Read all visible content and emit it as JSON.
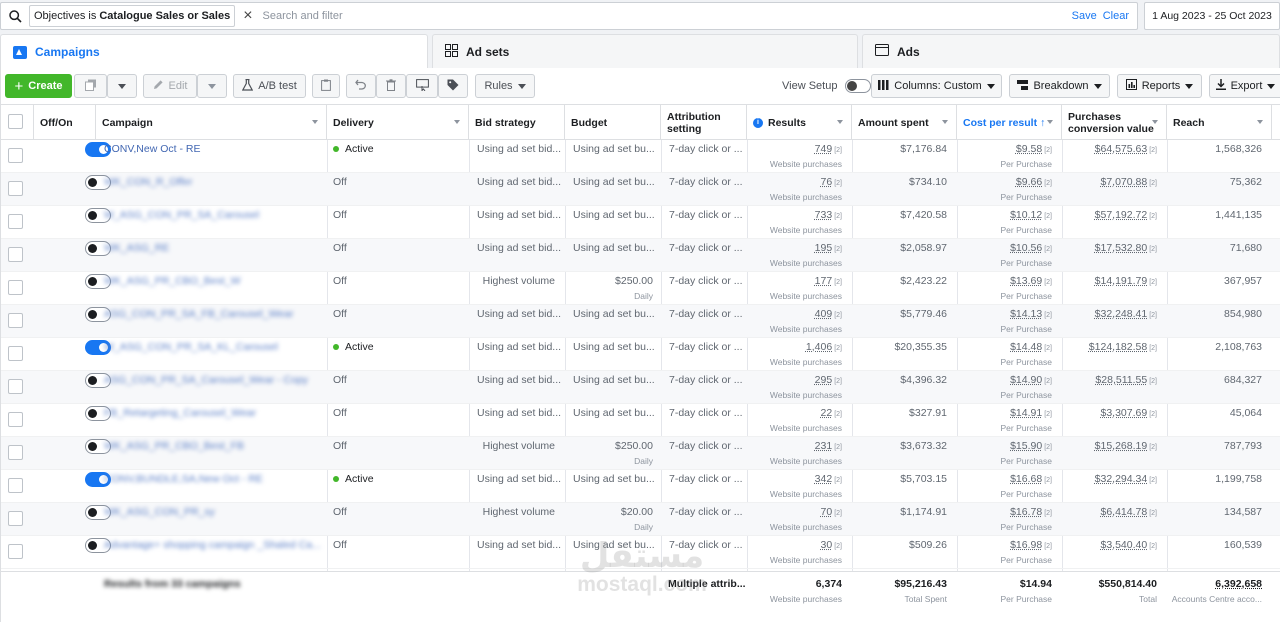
{
  "filter": {
    "chip_prefix": "Objectives is",
    "chip_value": "Catalogue Sales or Sales",
    "placeholder": "Search and filter",
    "save": "Save",
    "clear": "Clear",
    "date_range": "1 Aug 2023 - 25 Oct 2023"
  },
  "tabs": {
    "campaigns": "Campaigns",
    "adsets": "Ad sets",
    "ads": "Ads"
  },
  "toolbar": {
    "create": "Create",
    "edit": "Edit",
    "ab_test": "A/B test",
    "rules": "Rules",
    "view_setup": "View Setup",
    "columns": "Columns: Custom",
    "breakdown": "Breakdown",
    "reports": "Reports",
    "export": "Export"
  },
  "columns": {
    "offon": "Off/On",
    "campaign": "Campaign",
    "delivery": "Delivery",
    "bid": "Bid strategy",
    "budget": "Budget",
    "attribution_1": "Attribution",
    "attribution_2": "setting",
    "results": "Results",
    "spent": "Amount spent",
    "cpr": "Cost per result",
    "pcv_1": "Purchases",
    "pcv_2": "conversion value",
    "reach": "Reach"
  },
  "rows": [
    {
      "on": true,
      "campaign": "CONV,New Oct - RE",
      "blur": false,
      "delivery": "Active",
      "active": true,
      "bid": "Using ad set bid...",
      "budget": "Using ad set bu...",
      "budget_sub": "",
      "attribution": "7-day click or ...",
      "results": "749",
      "results_sub": "Website purchases",
      "spent": "$7,176.84",
      "cpr": "$9.58",
      "cpr_sub": "Per Purchase",
      "pcv": "$64,575.63",
      "reach": "1,568,326"
    },
    {
      "on": false,
      "campaign": "WK_CON_R_Offer",
      "blur": true,
      "delivery": "Off",
      "active": false,
      "bid": "Using ad set bid...",
      "budget": "Using ad set bu...",
      "budget_sub": "",
      "attribution": "7-day click or ...",
      "results": "76",
      "results_sub": "Website purchases",
      "spent": "$734.10",
      "cpr": "$9.66",
      "cpr_sub": "Per Purchase",
      "pcv": "$7,070.88",
      "reach": "75,362"
    },
    {
      "on": false,
      "campaign": "W_ASG_CON_PR_SA_Carousel",
      "blur": true,
      "delivery": "Off",
      "active": false,
      "bid": "Using ad set bid...",
      "budget": "Using ad set bu...",
      "budget_sub": "",
      "attribution": "7-day click or ...",
      "results": "733",
      "results_sub": "Website purchases",
      "spent": "$7,420.58",
      "cpr": "$10.12",
      "cpr_sub": "Per Purchase",
      "pcv": "$57,192.72",
      "reach": "1,441,135"
    },
    {
      "on": false,
      "campaign": "WK_ASG_RE",
      "blur": true,
      "delivery": "Off",
      "active": false,
      "bid": "Using ad set bid...",
      "budget": "Using ad set bu...",
      "budget_sub": "",
      "attribution": "7-day click or ...",
      "results": "195",
      "results_sub": "Website purchases",
      "spent": "$2,058.97",
      "cpr": "$10.56",
      "cpr_sub": "Per Purchase",
      "pcv": "$17,532.80",
      "reach": "71,680"
    },
    {
      "on": false,
      "campaign": "WK_ASG_PR_CBO_Best_W",
      "blur": true,
      "delivery": "Off",
      "active": false,
      "bid": "Highest volume",
      "budget": "$250.00",
      "budget_sub": "Daily",
      "attribution": "7-day click or ...",
      "results": "177",
      "results_sub": "Website purchases",
      "spent": "$2,423.22",
      "cpr": "$13.69",
      "cpr_sub": "Per Purchase",
      "pcv": "$14,191.79",
      "reach": "367,957"
    },
    {
      "on": false,
      "campaign": "ASG_CON_PR_SA_FB_Carousel_Wear",
      "blur": true,
      "delivery": "Off",
      "active": false,
      "bid": "Using ad set bid...",
      "budget": "Using ad set bu...",
      "budget_sub": "",
      "attribution": "7-day click or ...",
      "results": "409",
      "results_sub": "Website purchases",
      "spent": "$5,779.46",
      "cpr": "$14.13",
      "cpr_sub": "Per Purchase",
      "pcv": "$32,248.41",
      "reach": "854,980"
    },
    {
      "on": true,
      "campaign": "W_ASG_CON_PR_SA_KL_Carousel",
      "blur": true,
      "delivery": "Active",
      "active": true,
      "bid": "Using ad set bid...",
      "budget": "Using ad set bu...",
      "budget_sub": "",
      "attribution": "7-day click or ...",
      "results": "1,406",
      "results_sub": "Website purchases",
      "spent": "$20,355.35",
      "cpr": "$14.48",
      "cpr_sub": "Per Purchase",
      "pcv": "$124,182.58",
      "reach": "2,108,763"
    },
    {
      "on": false,
      "campaign": "ASG_CON_PR_SA_Carousel_Wear - Copy",
      "blur": true,
      "delivery": "Off",
      "active": false,
      "bid": "Using ad set bid...",
      "budget": "Using ad set bu...",
      "budget_sub": "",
      "attribution": "7-day click or ...",
      "results": "295",
      "results_sub": "Website purchases",
      "spent": "$4,396.32",
      "cpr": "$14.90",
      "cpr_sub": "Per Purchase",
      "pcv": "$28,511.55",
      "reach": "684,327"
    },
    {
      "on": false,
      "campaign": "FB_Retargeting_Carousel_Wear",
      "blur": true,
      "delivery": "Off",
      "active": false,
      "bid": "Using ad set bid...",
      "budget": "Using ad set bu...",
      "budget_sub": "",
      "attribution": "7-day click or ...",
      "results": "22",
      "results_sub": "Website purchases",
      "spent": "$327.91",
      "cpr": "$14.91",
      "cpr_sub": "Per Purchase",
      "pcv": "$3,307.69",
      "reach": "45,064"
    },
    {
      "on": false,
      "campaign": "WK_ASG_PR_CBO_Best_FB",
      "blur": true,
      "delivery": "Off",
      "active": false,
      "bid": "Highest volume",
      "budget": "$250.00",
      "budget_sub": "Daily",
      "attribution": "7-day click or ...",
      "results": "231",
      "results_sub": "Website purchases",
      "spent": "$3,673.32",
      "cpr": "$15.90",
      "cpr_sub": "Per Purchase",
      "pcv": "$15,268.19",
      "reach": "787,793"
    },
    {
      "on": true,
      "campaign": "CONV,BUNDLE,SA,New Oct - RE",
      "blur": true,
      "delivery": "Active",
      "active": true,
      "bid": "Using ad set bid...",
      "budget": "Using ad set bu...",
      "budget_sub": "",
      "attribution": "7-day click or ...",
      "results": "342",
      "results_sub": "Website purchases",
      "spent": "$5,703.15",
      "cpr": "$16.68",
      "cpr_sub": "Per Purchase",
      "pcv": "$32,294.34",
      "reach": "1,199,758"
    },
    {
      "on": false,
      "campaign": "WK_ASG_CON_PR_sy",
      "blur": true,
      "delivery": "Off",
      "active": false,
      "bid": "Highest volume",
      "budget": "$20.00",
      "budget_sub": "Daily",
      "attribution": "7-day click or ...",
      "results": "70",
      "results_sub": "Website purchases",
      "spent": "$1,174.91",
      "cpr": "$16.78",
      "cpr_sub": "Per Purchase",
      "pcv": "$6,414.78",
      "reach": "134,587"
    },
    {
      "on": false,
      "campaign": "Advantage+ shopping campaign _Shaled Ca...",
      "blur": true,
      "delivery": "Off",
      "active": false,
      "bid": "Using ad set bid...",
      "budget": "Using ad set bu...",
      "budget_sub": "",
      "attribution": "7-day click or ...",
      "results": "30",
      "results_sub": "Website purchases",
      "spent": "$509.26",
      "cpr": "$16.98",
      "cpr_sub": "Per Purchase",
      "pcv": "$3,540.40",
      "reach": "160,539"
    }
  ],
  "totals": {
    "label": "Results from 33 campaigns",
    "attribution": "Multiple attrib...",
    "results": "6,374",
    "results_sub": "Website purchases",
    "spent": "$95,216.43",
    "spent_sub": "Total Spent",
    "cpr": "$14.94",
    "cpr_sub": "Per Purchase",
    "pcv": "$550,814.40",
    "pcv_sub": "Total",
    "reach": "6,392,658",
    "reach_sub": "Accounts Centre acco..."
  },
  "watermark": {
    "arabic": "مستقل",
    "latin": "mostaql.com"
  },
  "colors": {
    "accent": "#1877f2",
    "create": "#42b72a",
    "active_dot": "#42b72a"
  }
}
